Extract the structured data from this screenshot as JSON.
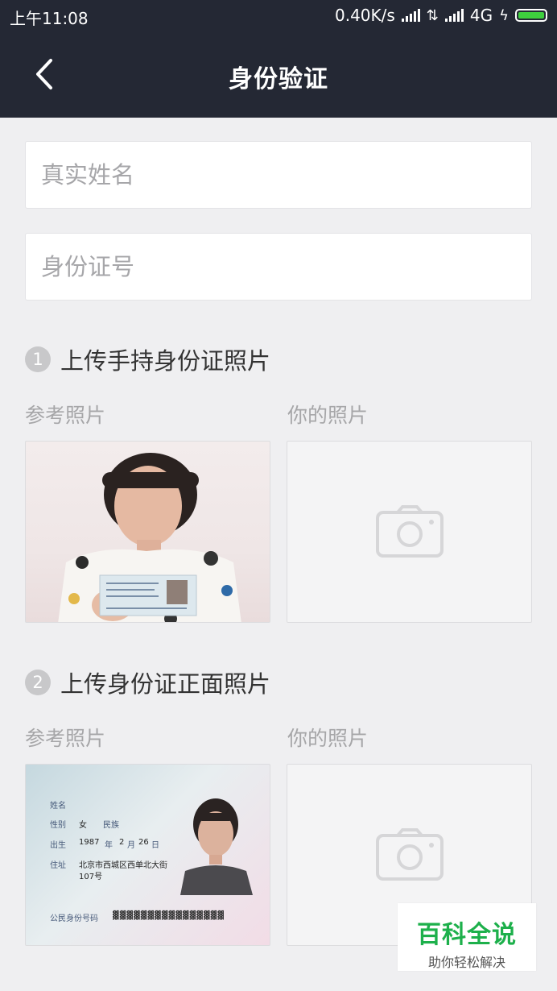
{
  "status_bar": {
    "time": "上午11:08",
    "speed": "0.40K/s",
    "network": "4G"
  },
  "nav": {
    "title": "身份验证",
    "back_icon": "chevron-left-icon"
  },
  "form": {
    "name_placeholder": "真实姓名",
    "name_value": "",
    "id_placeholder": "身份证号",
    "id_value": ""
  },
  "steps": [
    {
      "number": "1",
      "title": "上传手持身份证照片",
      "reference_label": "参考照片",
      "yours_label": "你的照片",
      "upload_icon": "camera-icon"
    },
    {
      "number": "2",
      "title": "上传身份证正面照片",
      "reference_label": "参考照片",
      "yours_label": "你的照片",
      "upload_icon": "camera-icon"
    }
  ],
  "id_card": {
    "name_label": "姓名",
    "gender_label": "性别",
    "gender_value": "女",
    "ethnicity_label": "民族",
    "birth_label": "出生",
    "birth_year": "1987",
    "birth_year_unit": "年",
    "birth_month": "2",
    "birth_month_unit": "月",
    "birth_day": "26",
    "birth_day_unit": "日",
    "address_label": "住址",
    "address_value": "北京市西城区西单北大街",
    "address_value2": "107号",
    "id_number_label": "公民身份号码"
  },
  "watermark": {
    "title": "百科全说",
    "subtitle": "助你轻松解决"
  },
  "colors": {
    "header_bg": "#242834",
    "page_bg": "#efeff1",
    "battery_green": "#3ecf3e",
    "watermark_green": "#1db04b"
  }
}
